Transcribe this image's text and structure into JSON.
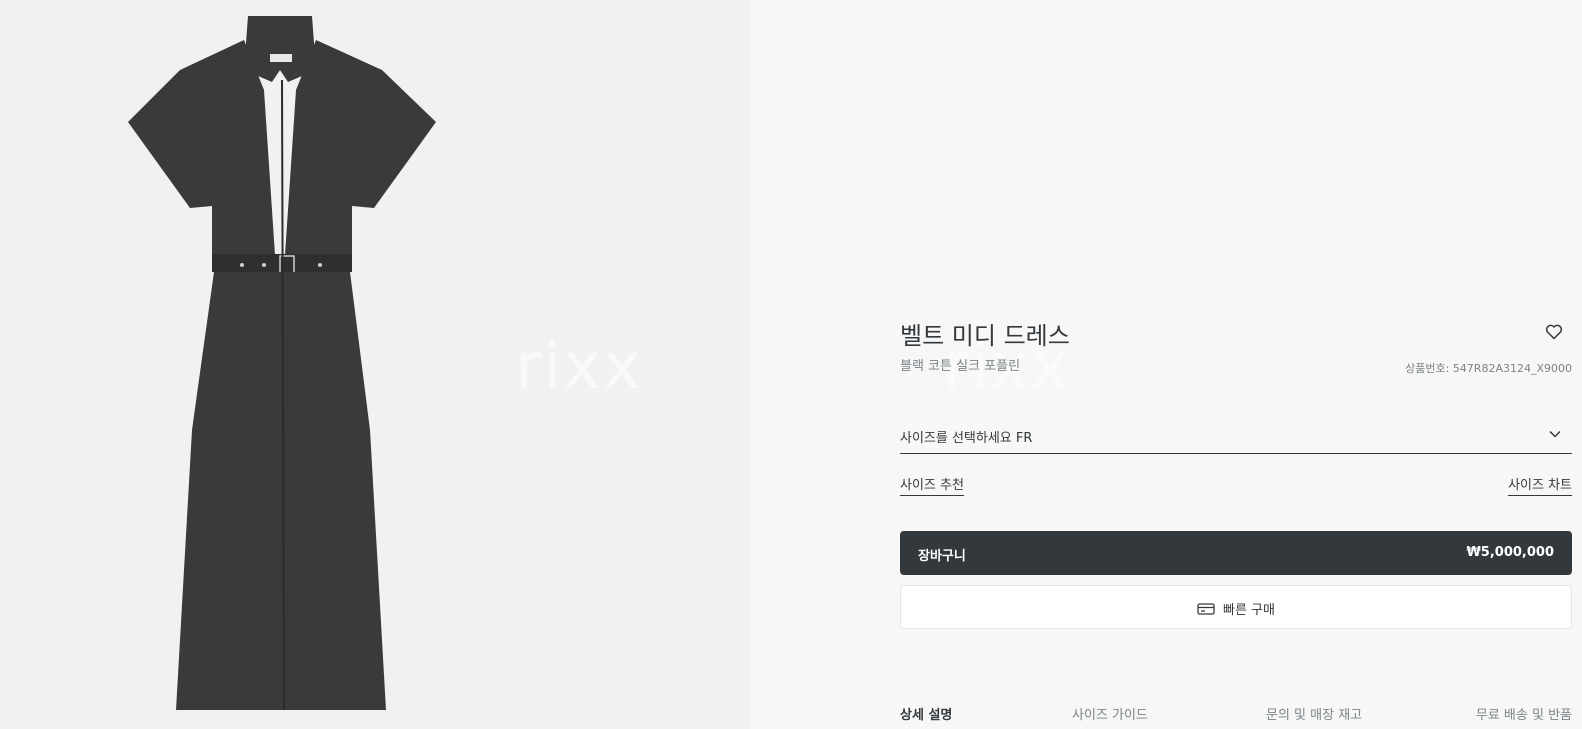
{
  "product": {
    "title": "벨트 미디 드레스",
    "subtitle": "블랙 코튼 실크 포플린",
    "code_label": "상품번호: 547R82A3124_X9000"
  },
  "watermark": "rixx",
  "size_selector": {
    "label": "사이즈를 선택하세요 FR"
  },
  "links": {
    "size_recommendation": "사이즈 추천",
    "size_chart": "사이즈 차트"
  },
  "cart": {
    "label": "장바구니",
    "price": "₩5,000,000"
  },
  "quick_buy": {
    "label": "빠른 구매"
  },
  "tabs": [
    {
      "label": "상세 설명"
    },
    {
      "label": "사이즈 가이드"
    },
    {
      "label": "문의 및 매장 재고"
    },
    {
      "label": "무료 배송 및 반품"
    }
  ],
  "icons": {
    "wishlist": "heart-icon",
    "dropdown": "chevron-down-icon",
    "quick_buy": "credit-card-icon"
  },
  "colors": {
    "accent": "#33383c",
    "dress": "#3a3a3b",
    "left_bg": "#f1f1f3",
    "right_bg": "#f7f7f7"
  }
}
